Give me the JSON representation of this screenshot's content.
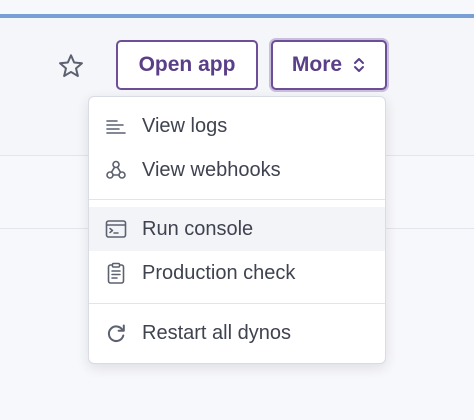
{
  "header": {
    "favorite_icon": "star-outline-icon",
    "open_app_label": "Open app",
    "more_label": "More",
    "more_icon": "chevron-up-down-icon"
  },
  "colors": {
    "accent_bar": "#79a0d6",
    "button_border": "#6c4f97",
    "button_text": "#5a3f88"
  },
  "menu": {
    "items": [
      {
        "label": "View logs",
        "icon": "logs-icon"
      },
      {
        "label": "View webhooks",
        "icon": "webhooks-icon"
      },
      {
        "label": "Run console",
        "icon": "console-icon",
        "highlighted": true
      },
      {
        "label": "Production check",
        "icon": "clipboard-check-icon"
      },
      {
        "label": "Restart all dynos",
        "icon": "restart-icon"
      }
    ]
  }
}
